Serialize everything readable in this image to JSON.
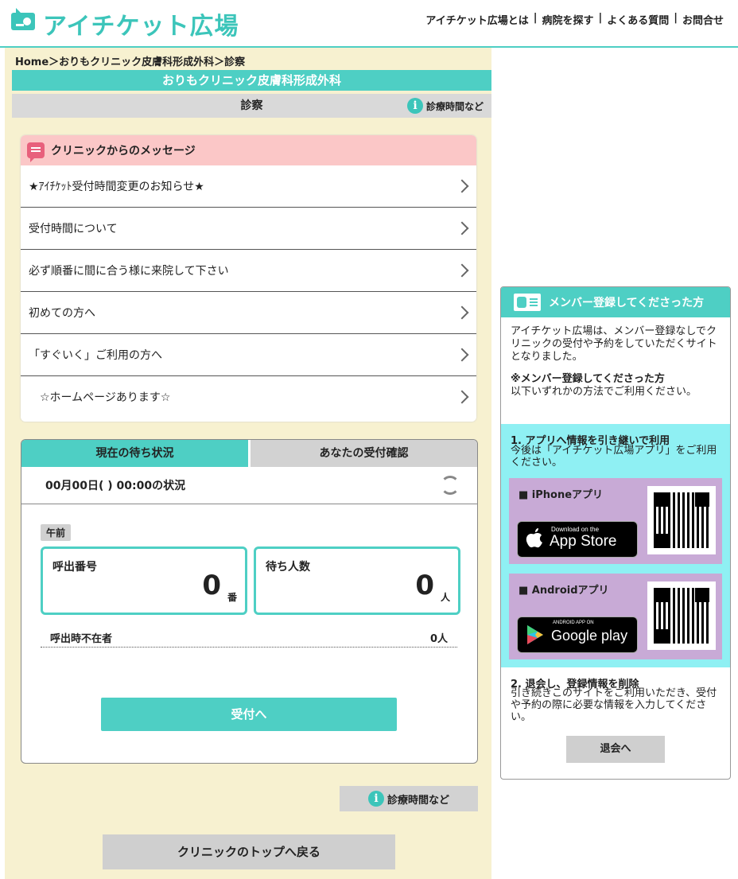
{
  "header": {
    "logo": "アイチケット広場",
    "nav": [
      "アイチケット広場とは",
      "病院を探す",
      "よくある質問",
      "お問合せ"
    ],
    "separator": "|"
  },
  "breadcrumb": "Home＞おりもクリニック皮膚科形成外科＞診察",
  "clinic_name": "おりもクリニック皮膚科形成外科",
  "department": "診察",
  "hours_link": "診療時間など",
  "messages": {
    "title": "クリニックからのメッセージ",
    "items": [
      "★ｱｲﾁｹｯﾄ受付時間変更のお知らせ★",
      "受付時間について",
      "必ず順番に間に合う様に来院して下さい",
      "初めての方へ",
      "「すぐいく」ご利用の方へ",
      "　☆ホームページあります☆"
    ]
  },
  "waiting": {
    "tabs": [
      "現在の待ち状況",
      "あなたの受付確認"
    ],
    "status_time": "00月00日( ) 00:00の状況",
    "period": "午前",
    "call_number_label": "呼出番号",
    "call_number": "0",
    "call_number_unit": "番",
    "waiting_label": "待ち人数",
    "waiting_count": "0",
    "waiting_unit": "人",
    "absent_label": "呼出時不在者",
    "absent_value": "0人",
    "register_button": "受付へ"
  },
  "hours_button": "診療時間など",
  "back_button": "クリニックのトップへ戻る",
  "sidebar": {
    "title": "メンバー登録してくださった方",
    "intro": "アイチケット広場は、メンバー登録なしでクリニックの受付や予約をしていただくサイトとなりました。",
    "note_title": "※メンバー登録してくださった方",
    "note_text": "以下いずれかの方法でご利用ください。",
    "app_title": "1. アプリへ情報を引き継いで利用",
    "app_desc": "今後は「アイチケット広場アプリ」をご利用ください。",
    "iphone_label": "■ iPhoneアプリ",
    "appstore_small": "Download on the",
    "appstore_big": "App Store",
    "android_label": "■ Androidアプリ",
    "gplay_small": "ANDROID APP ON",
    "gplay_big": "Google play",
    "withdraw_title": "2. 退会し、登録情報を削除",
    "withdraw_desc": "引き続きこのサイトをご利用いただき、受付や予約の際に必要な情報を入力してください。",
    "withdraw_button": "退会へ"
  },
  "colors": {
    "accent": "#4ecfc4",
    "cream": "#f7f1d0",
    "pink": "#fbc7c7",
    "aqua": "#8ff0f3",
    "lilac": "#c8aad6"
  }
}
